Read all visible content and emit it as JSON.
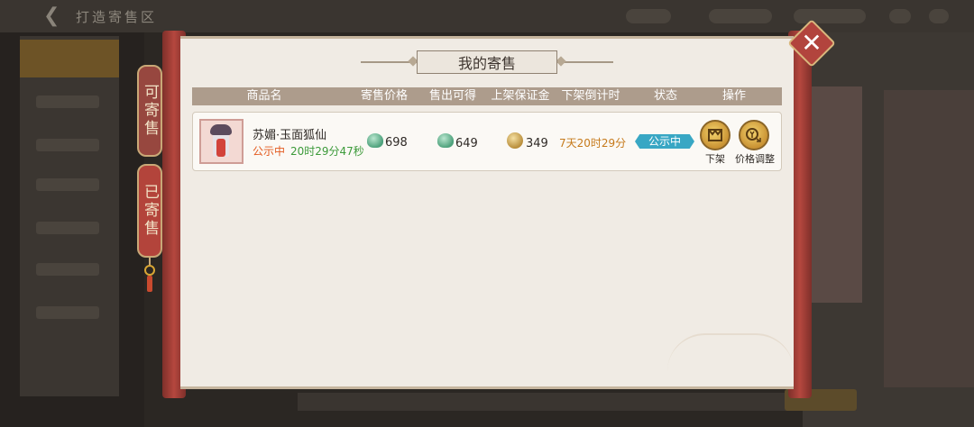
{
  "background": {
    "title": "打造寄售区"
  },
  "tabs": [
    {
      "label": "可寄售",
      "active": false
    },
    {
      "label": "已寄售",
      "active": true
    }
  ],
  "dialog": {
    "title": "我的寄售"
  },
  "table": {
    "headers": [
      "商品名",
      "寄售价格",
      "售出可得",
      "上架保证金",
      "下架倒计时",
      "状态",
      "操作"
    ],
    "rows": [
      {
        "name": "苏媚·玉面狐仙",
        "status_text": "公示中",
        "timer": "20时29分47秒",
        "price": "698",
        "proceeds": "649",
        "deposit": "349",
        "countdown": "7天20时29分",
        "state": "公示中",
        "actions": [
          "下架",
          "价格调整"
        ]
      }
    ]
  },
  "colors": {
    "panel": "#f0ebe4",
    "header": "#ad9c8c",
    "status_badge": "#38a7c4",
    "status_text": "#e35a1f",
    "timer_text": "#3c9a3a",
    "countdown_text": "#c67a1b",
    "scroll_rod": "#b5473e"
  },
  "icons": {
    "close": "close-icon",
    "price_currency": "jade-coin-icon",
    "deposit_currency": "gold-coin-icon",
    "delist": "delist-icon",
    "adjust_price": "adjust-price-icon"
  }
}
